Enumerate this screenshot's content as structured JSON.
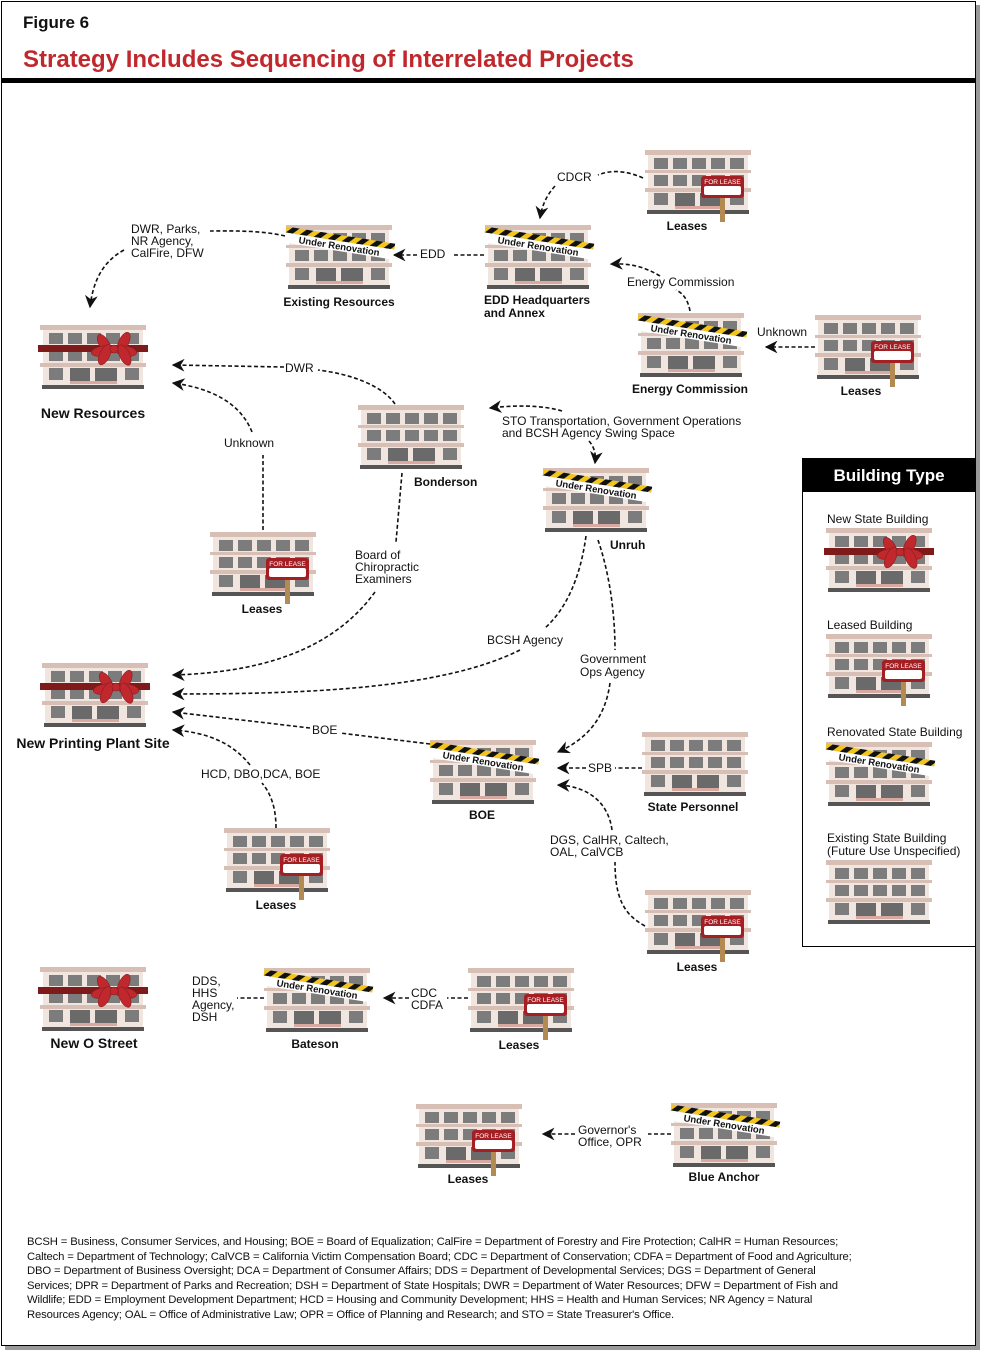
{
  "header": {
    "figure_label": "Figure 6",
    "title": "Strategy Includes Sequencing of Interrelated Projects"
  },
  "graphics": {
    "lease_sign": "FOR LEASE",
    "renovation_tape": "Under Renovation"
  },
  "colors": {
    "title_red": "#c0282d",
    "ribbon_red": "#c0282d",
    "sign_red": "#a31f24",
    "tape_yellow": "#f2c51c"
  },
  "nodes": {
    "leases_cdcr": {
      "label": "Leases",
      "type": "leased"
    },
    "existing_resources": {
      "label": "Existing Resources",
      "type": "renovated"
    },
    "edd_hq": {
      "label_line1": "EDD Headquarters",
      "label_line2": "and Annex",
      "type": "renovated"
    },
    "new_resources": {
      "label": "New Resources",
      "type": "new"
    },
    "energy_commission": {
      "label": "Energy Commission",
      "type": "renovated"
    },
    "leases_energy": {
      "label": "Leases",
      "type": "leased"
    },
    "bonderson": {
      "label": "Bonderson",
      "type": "existing"
    },
    "unruh": {
      "label": "Unruh",
      "type": "renovated"
    },
    "leases_dwr": {
      "label": "Leases",
      "type": "leased"
    },
    "new_printing_plant": {
      "label": "New Printing Plant Site",
      "type": "new"
    },
    "boe": {
      "label": "BOE",
      "type": "renovated"
    },
    "state_personnel": {
      "label": "State Personnel",
      "type": "existing"
    },
    "leases_hcd": {
      "label": "Leases",
      "type": "leased"
    },
    "leases_dgs": {
      "label": "Leases",
      "type": "leased"
    },
    "new_o_street": {
      "label": "New O Street",
      "type": "new"
    },
    "bateson": {
      "label": "Bateson",
      "type": "renovated"
    },
    "leases_cdc": {
      "label": "Leases",
      "type": "leased"
    },
    "leases_gov": {
      "label": "Leases",
      "type": "leased"
    },
    "blue_anchor": {
      "label": "Blue Anchor",
      "type": "renovated"
    }
  },
  "edges": {
    "cdcr": "CDCR",
    "edd": "EDD",
    "dwr_parks": [
      "DWR, Parks,",
      "NR Agency,",
      "CalFire, DFW"
    ],
    "energy_commission": "Energy Commission",
    "unknown_energy": "Unknown",
    "dwr": "DWR",
    "unknown_leases": "Unknown",
    "sto": [
      "STO Transportation, Government Operations",
      "and BCSH Agency Swing Space"
    ],
    "chiropractic": [
      "Board of",
      "Chiropractic",
      "Examiners"
    ],
    "bcsh": "BCSH Agency",
    "gov_ops": [
      "Government",
      "Ops Agency"
    ],
    "boe": "BOE",
    "hcd": "HCD, DBO,DCA, BOE",
    "spb": "SPB",
    "dgs": [
      "DGS, CalHR, Caltech,",
      "OAL, CalVCB"
    ],
    "dds": [
      "DDS,",
      "HHS",
      "Agency,",
      "DSH"
    ],
    "cdc": [
      "CDC",
      "CDFA"
    ],
    "governor": [
      "Governor's",
      "Office, OPR"
    ]
  },
  "legend": {
    "title": "Building Type",
    "items": [
      {
        "label": "New State Building",
        "type": "new"
      },
      {
        "label": "Leased Building",
        "type": "leased"
      },
      {
        "label": "Renovated State Building",
        "type": "renovated"
      },
      {
        "label_line1": "Existing State Building",
        "label_line2": "(Future Use Unspecified)",
        "type": "existing"
      }
    ]
  },
  "footnote": [
    "BCSH = Business, Consumer Services, and Housing; BOE = Board of Equalization; CalFire = Department of Forestry and Fire Protection; CalHR = Human Resources;",
    "Caltech = Department of Technology; CalVCB = California Victim Compensation Board; CDC = Department of Conservation; CDFA = Department of Food and Agriculture;",
    "DBO = Department of Business Oversight; DCA = Department of Consumer Affairs; DDS = Department of Developmental Services; DGS = Department of General",
    "Services; DPR = Department of Parks and Recreation; DSH = Department of State Hospitals; DWR = Department of Water Resources; DFW = Department of Fish and",
    "Wildlife; EDD = Employment Development Department; HCD = Housing and Community Development; HHS = Health and Human Services; NR Agency = Natural",
    "Resources Agency; OAL = Office of Administrative Law; OPR = Office of Planning and Research; and STO = State Treasurer's Office."
  ]
}
